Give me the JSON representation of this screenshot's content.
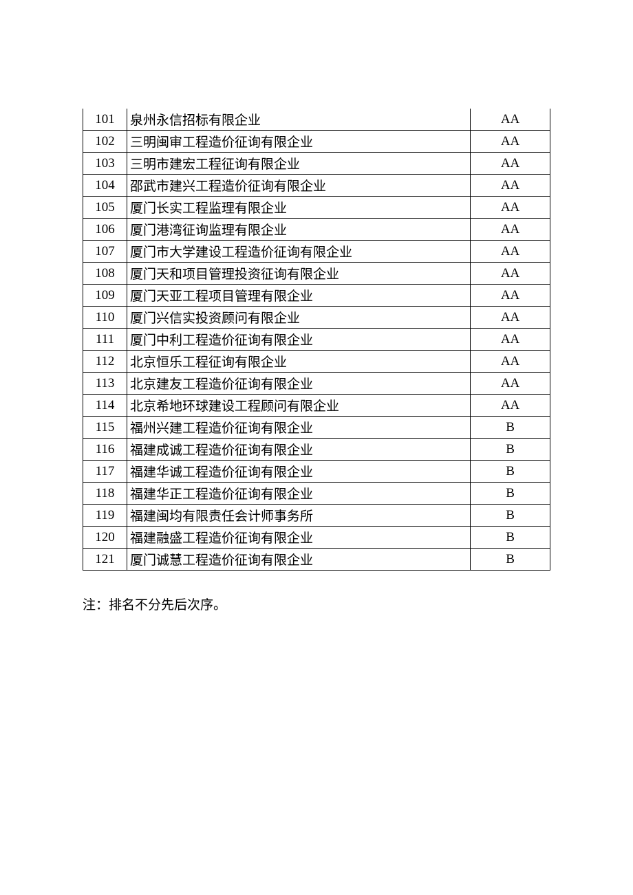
{
  "chart_data": {
    "type": "table",
    "rows": [
      {
        "index": "101",
        "name": "泉州永信招标有限企业",
        "rating": "AA"
      },
      {
        "index": "102",
        "name": "三明闽审工程造价征询有限企业",
        "rating": "AA"
      },
      {
        "index": "103",
        "name": "三明市建宏工程征询有限企业",
        "rating": "AA"
      },
      {
        "index": "104",
        "name": "邵武市建兴工程造价征询有限企业",
        "rating": "AA"
      },
      {
        "index": "105",
        "name": "厦门长实工程监理有限企业",
        "rating": "AA"
      },
      {
        "index": "106",
        "name": "厦门港湾征询监理有限企业",
        "rating": "AA"
      },
      {
        "index": "107",
        "name": "厦门市大学建设工程造价征询有限企业",
        "rating": "AA"
      },
      {
        "index": "108",
        "name": "厦门天和项目管理投资征询有限企业",
        "rating": "AA"
      },
      {
        "index": "109",
        "name": "厦门天亚工程项目管理有限企业",
        "rating": "AA"
      },
      {
        "index": "110",
        "name": "厦门兴信实投资顾问有限企业",
        "rating": "AA"
      },
      {
        "index": "111",
        "name": "厦门中利工程造价征询有限企业",
        "rating": "AA"
      },
      {
        "index": "112",
        "name": "北京恒乐工程征询有限企业",
        "rating": "AA"
      },
      {
        "index": "113",
        "name": "北京建友工程造价征询有限企业",
        "rating": "AA"
      },
      {
        "index": "114",
        "name": "北京希地环球建设工程顾问有限企业",
        "rating": "AA"
      },
      {
        "index": "115",
        "name": "福州兴建工程造价征询有限企业",
        "rating": "B"
      },
      {
        "index": "116",
        "name": "福建成诚工程造价征询有限企业",
        "rating": "B"
      },
      {
        "index": "117",
        "name": "福建华诚工程造价征询有限企业",
        "rating": "B"
      },
      {
        "index": "118",
        "name": "福建华正工程造价征询有限企业",
        "rating": "B"
      },
      {
        "index": "119",
        "name": "福建闽均有限责任会计师事务所",
        "rating": "B"
      },
      {
        "index": "120",
        "name": "福建融盛工程造价征询有限企业",
        "rating": "B"
      },
      {
        "index": "121",
        "name": "厦门诚慧工程造价征询有限企业",
        "rating": "B"
      }
    ]
  },
  "note": "注：排名不分先后次序。"
}
